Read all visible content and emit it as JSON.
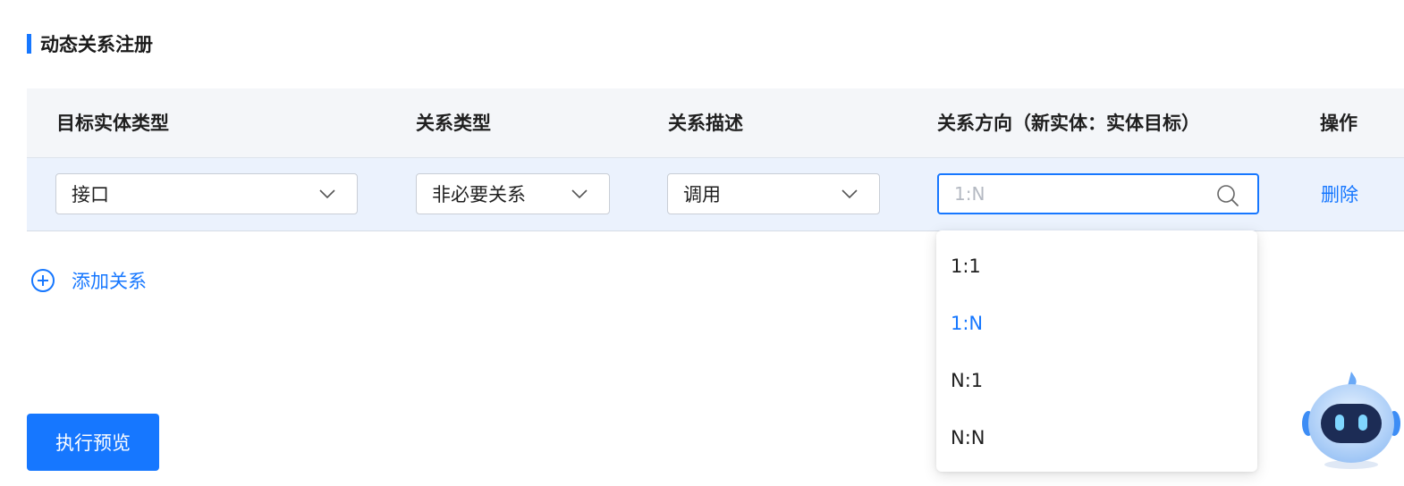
{
  "section": {
    "title": "动态关系注册"
  },
  "table": {
    "headers": {
      "target_entity_type": "目标实体类型",
      "relation_type": "关系类型",
      "relation_desc": "关系描述",
      "relation_direction": "关系方向（新实体：实体目标）",
      "operation": "操作"
    },
    "row": {
      "target_entity_type": "接口",
      "relation_type": "非必要关系",
      "relation_desc": "调用",
      "relation_direction_placeholder": "1:N",
      "delete_label": "删除"
    }
  },
  "add_relation_label": "添加关系",
  "direction_dropdown": {
    "options": [
      "1:1",
      "1:N",
      "N:1",
      "N:N"
    ],
    "selected": "1:N"
  },
  "run_preview_label": "执行预览",
  "colors": {
    "accent": "#1677ff",
    "header_bg": "#f4f6f9",
    "row_bg": "#ebf2fd"
  },
  "icons": {
    "chevron": "chevron-down-icon",
    "search": "search-icon",
    "add": "plus-circle-icon",
    "assistant": "robot-assistant-icon"
  }
}
